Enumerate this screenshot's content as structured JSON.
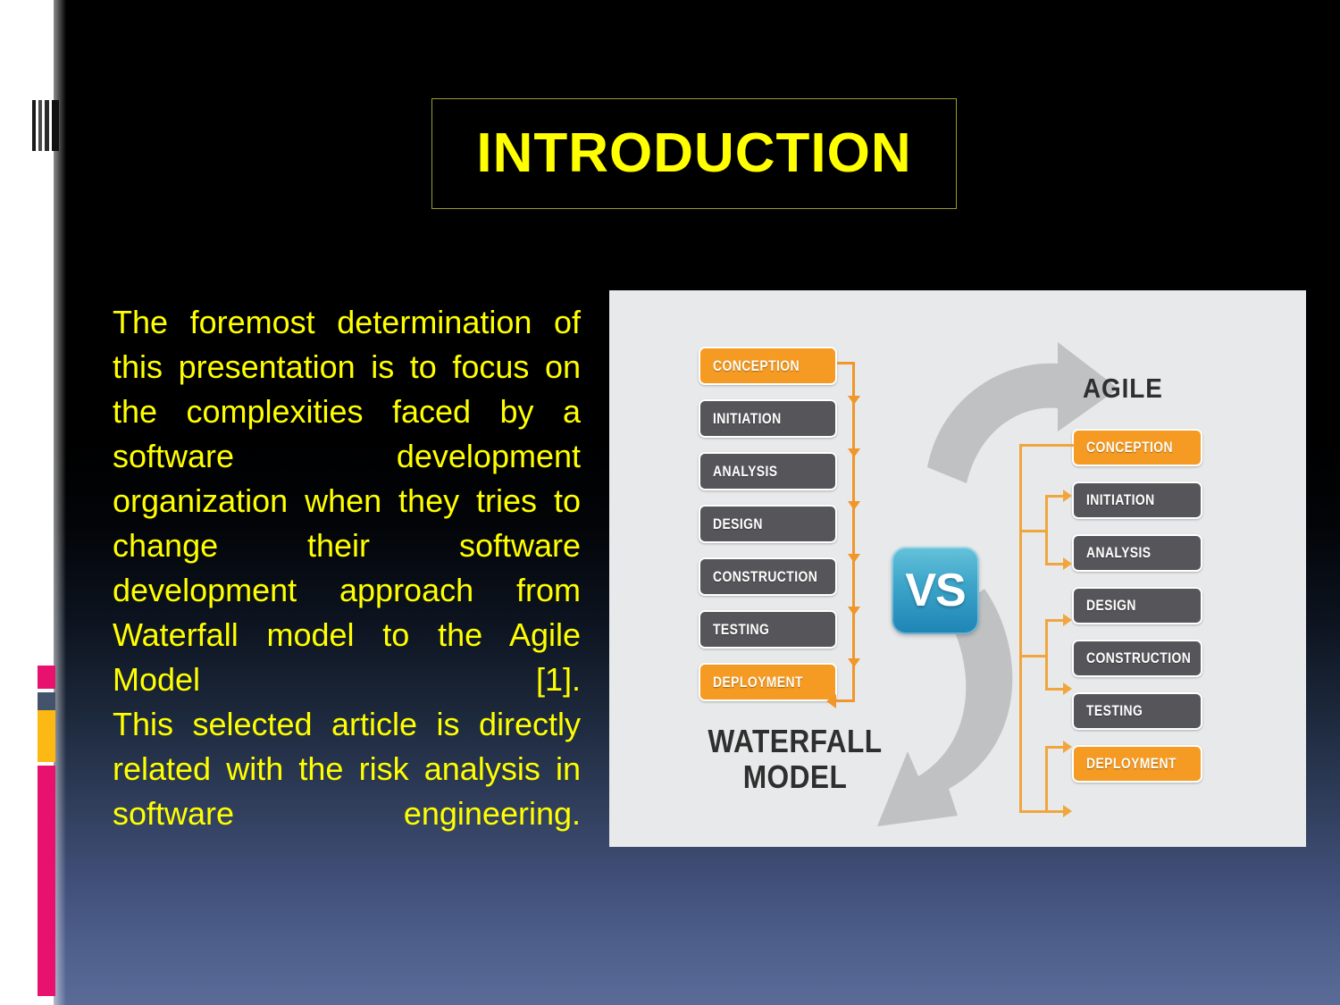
{
  "slide": {
    "title": "INTRODUCTION",
    "title_color": "#ffff00",
    "background_top": "#000000",
    "background_bottom": "#5a6b98"
  },
  "body": {
    "paragraph_1": "The foremost determination of this presentation is to focus on the complexities faced by a software development organization when they tries to change their software development approach from Waterfall model to the Agile Model [1].",
    "paragraph_2": "This selected article is directly related with the risk analysis in software engineering."
  },
  "diagram": {
    "vs_label": "VS",
    "waterfall_heading_line1": "WATERFALL",
    "waterfall_heading_line2": "MODEL",
    "agile_heading": "AGILE",
    "waterfall_stages": [
      {
        "label": "CONCEPTION",
        "style": "orange"
      },
      {
        "label": "INITIATION",
        "style": "dark"
      },
      {
        "label": "ANALYSIS",
        "style": "dark"
      },
      {
        "label": "DESIGN",
        "style": "dark"
      },
      {
        "label": "CONSTRUCTION",
        "style": "dark"
      },
      {
        "label": "TESTING",
        "style": "dark"
      },
      {
        "label": "DEPLOYMENT",
        "style": "orange"
      }
    ],
    "agile_stages": [
      {
        "label": "CONCEPTION",
        "style": "orange"
      },
      {
        "label": "INITIATION",
        "style": "dark"
      },
      {
        "label": "ANALYSIS",
        "style": "dark"
      },
      {
        "label": "DESIGN",
        "style": "dark"
      },
      {
        "label": "CONSTRUCTION",
        "style": "dark"
      },
      {
        "label": "TESTING",
        "style": "dark"
      },
      {
        "label": "DEPLOYMENT",
        "style": "orange"
      }
    ],
    "colors": {
      "orange_node": "#f59a23",
      "dark_node": "#56565a",
      "connector": "#f0a63c",
      "panel_background": "#e8e9ea",
      "vs_badge_top": "#66c2da",
      "vs_badge_bottom": "#1d84b5",
      "curved_arrow": "#bfc1c3"
    }
  },
  "decoration": {
    "rail_color": "#ffffff",
    "segments": [
      {
        "name": "pink-top",
        "color": "#e8126e"
      },
      {
        "name": "slate",
        "color": "#43536b"
      },
      {
        "name": "gold",
        "color": "#fcb813"
      },
      {
        "name": "pink-long",
        "color": "#e8126e"
      }
    ]
  }
}
